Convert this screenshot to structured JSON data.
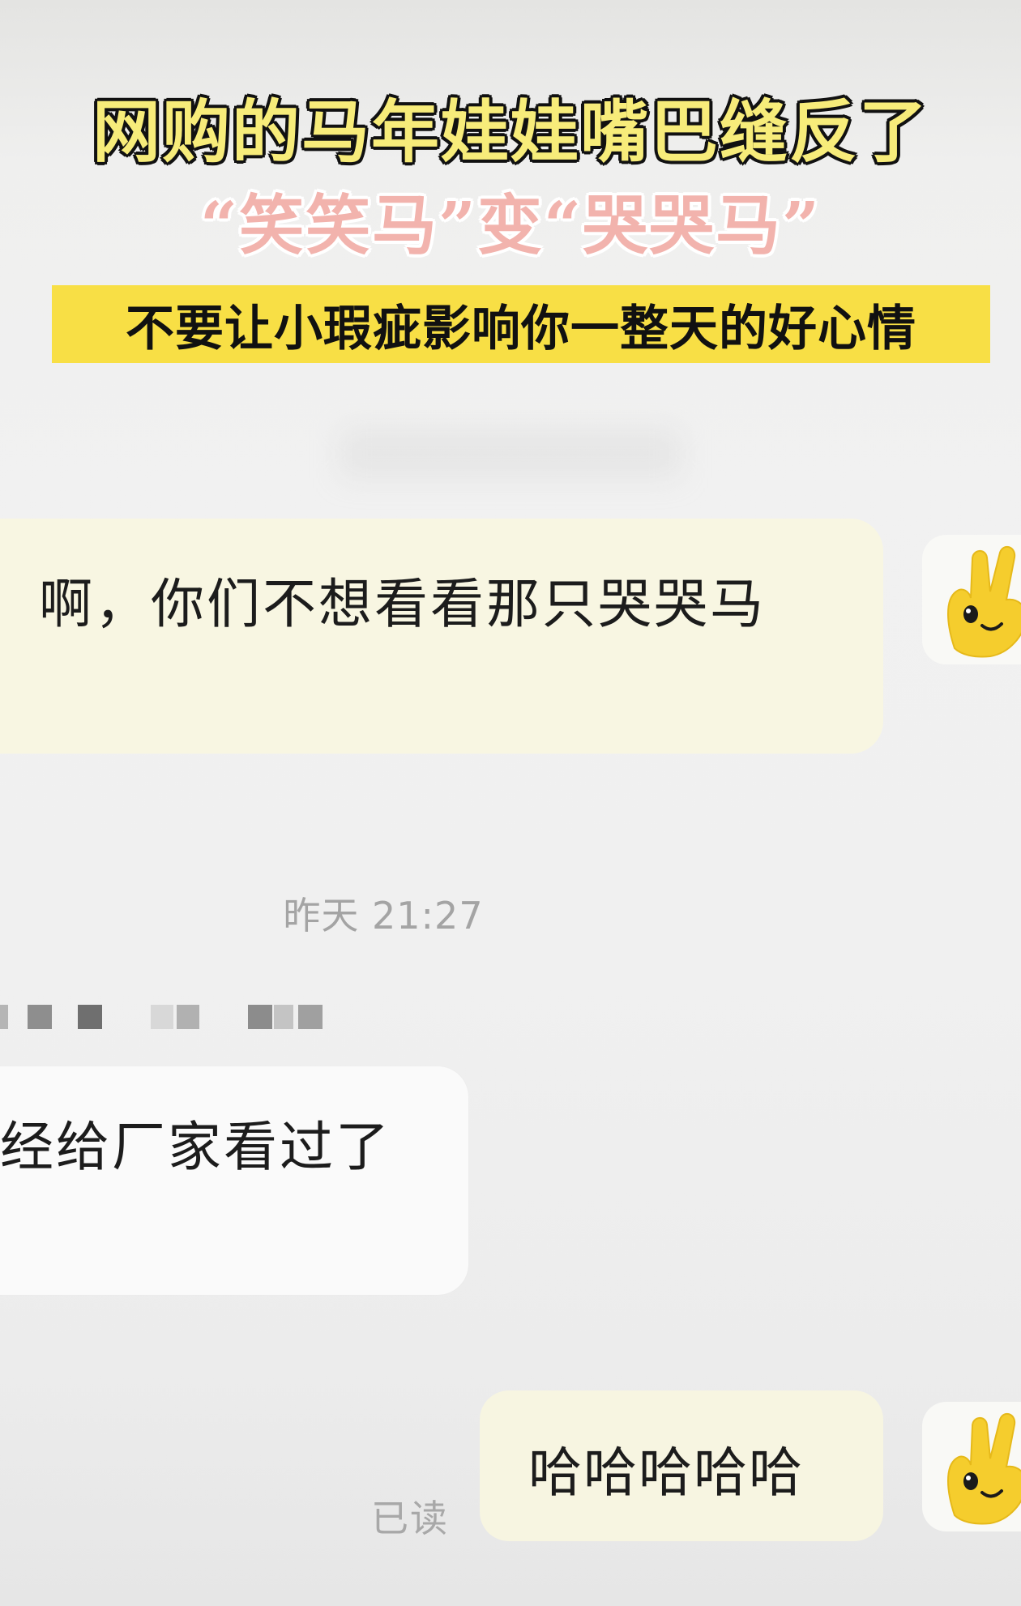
{
  "caption": {
    "title": "网购的马年娃娃嘴巴缝反了",
    "subtitle_prefix_quote_open": "“",
    "subtitle_word_a": "笑笑马",
    "subtitle_quote_close_a": "”",
    "subtitle_connector": "变",
    "subtitle_quote_open_b": "“",
    "subtitle_word_b": "哭哭马",
    "subtitle_quote_close_b": "”",
    "tagline": "不要让小瑕疵影响你一整天的好心情"
  },
  "chat": {
    "messages": [
      {
        "side": "right",
        "text": "啊，你们不想看看那只哭哭马"
      },
      {
        "side": "left",
        "text": "经给厂家看过了"
      },
      {
        "side": "right",
        "text": "哈哈哈哈哈",
        "status": "已读"
      }
    ],
    "timestamp": "昨天 21:27"
  },
  "colors": {
    "title_fill": "#f7ec7a",
    "subtitle_fill": "#f2b3ad",
    "tagline_band": "#f8df45",
    "own_bubble": "#f8f6e2",
    "other_bubble": "#fafafa"
  },
  "icons": {
    "avatar": "yellow-rabbit-hand-avatar"
  }
}
